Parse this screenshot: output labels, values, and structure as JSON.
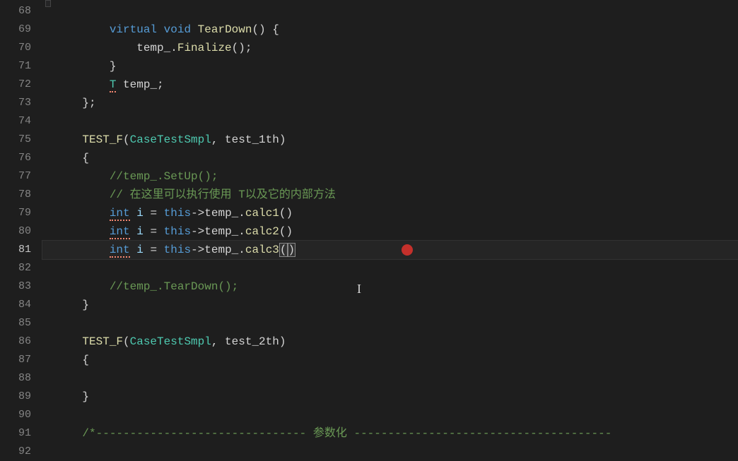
{
  "editor": {
    "first_line": 68,
    "active_line": 81,
    "lines": {
      "68": [
        {
          "t": "",
          "c": ""
        }
      ],
      "69": [
        {
          "t": "        ",
          "c": ""
        },
        {
          "t": "virtual",
          "c": "kw-virtual"
        },
        {
          "t": " ",
          "c": ""
        },
        {
          "t": "void",
          "c": "kw-void"
        },
        {
          "t": " ",
          "c": ""
        },
        {
          "t": "TearDown",
          "c": "kw-func"
        },
        {
          "t": "() {",
          "c": ""
        }
      ],
      "70": [
        {
          "t": "            ",
          "c": ""
        },
        {
          "t": "temp_",
          "c": "kw-member"
        },
        {
          "t": ".",
          "c": ""
        },
        {
          "t": "Finalize",
          "c": "kw-func"
        },
        {
          "t": "();",
          "c": ""
        }
      ],
      "71": [
        {
          "t": "        }",
          "c": ""
        }
      ],
      "72": [
        {
          "t": "        ",
          "c": ""
        },
        {
          "t": "T",
          "c": "kw-type underline-err"
        },
        {
          "t": " ",
          "c": ""
        },
        {
          "t": "temp_",
          "c": "kw-member"
        },
        {
          "t": ";",
          "c": ""
        }
      ],
      "73": [
        {
          "t": "    };",
          "c": ""
        }
      ],
      "74": [
        {
          "t": "",
          "c": ""
        }
      ],
      "75": [
        {
          "t": "    ",
          "c": ""
        },
        {
          "t": "TEST_F",
          "c": "kw-macro"
        },
        {
          "t": "(",
          "c": ""
        },
        {
          "t": "CaseTestSmpl",
          "c": "kw-class"
        },
        {
          "t": ", ",
          "c": ""
        },
        {
          "t": "test_1th",
          "c": "kw-member"
        },
        {
          "t": ")",
          "c": ""
        }
      ],
      "76": [
        {
          "t": "    {",
          "c": ""
        }
      ],
      "77": [
        {
          "t": "        ",
          "c": ""
        },
        {
          "t": "//temp_.SetUp();",
          "c": "kw-comment"
        }
      ],
      "78": [
        {
          "t": "        ",
          "c": ""
        },
        {
          "t": "// 在这里可以执行使用 T以及它的内部方法",
          "c": "kw-comment"
        }
      ],
      "79": [
        {
          "t": "        ",
          "c": ""
        },
        {
          "t": "int",
          "c": "kw-int underline-err"
        },
        {
          "t": " ",
          "c": ""
        },
        {
          "t": "i",
          "c": "kw-var"
        },
        {
          "t": " = ",
          "c": ""
        },
        {
          "t": "this",
          "c": "kw-this"
        },
        {
          "t": "->",
          "c": ""
        },
        {
          "t": "temp_",
          "c": "kw-member"
        },
        {
          "t": ".",
          "c": ""
        },
        {
          "t": "calc1",
          "c": "kw-func"
        },
        {
          "t": "()",
          "c": ""
        }
      ],
      "80": [
        {
          "t": "        ",
          "c": ""
        },
        {
          "t": "int",
          "c": "kw-int underline-err"
        },
        {
          "t": " ",
          "c": ""
        },
        {
          "t": "i",
          "c": "kw-var"
        },
        {
          "t": " = ",
          "c": ""
        },
        {
          "t": "this",
          "c": "kw-this"
        },
        {
          "t": "->",
          "c": ""
        },
        {
          "t": "temp_",
          "c": "kw-member"
        },
        {
          "t": ".",
          "c": ""
        },
        {
          "t": "calc2",
          "c": "kw-func"
        },
        {
          "t": "()",
          "c": ""
        }
      ],
      "81": [
        {
          "t": "        ",
          "c": ""
        },
        {
          "t": "int",
          "c": "kw-int underline-err"
        },
        {
          "t": " ",
          "c": ""
        },
        {
          "t": "i",
          "c": "kw-var"
        },
        {
          "t": " = ",
          "c": ""
        },
        {
          "t": "this",
          "c": "kw-this"
        },
        {
          "t": "->",
          "c": ""
        },
        {
          "t": "temp_",
          "c": "kw-member"
        },
        {
          "t": ".",
          "c": ""
        },
        {
          "t": "calc3",
          "c": "kw-func"
        },
        {
          "t": "(",
          "c": "bracket-highlight"
        },
        {
          "t": ")",
          "c": "bracket-highlight"
        }
      ],
      "82": [
        {
          "t": "",
          "c": ""
        }
      ],
      "83": [
        {
          "t": "        ",
          "c": ""
        },
        {
          "t": "//temp_.TearDown();",
          "c": "kw-comment"
        }
      ],
      "84": [
        {
          "t": "    }",
          "c": ""
        }
      ],
      "85": [
        {
          "t": "",
          "c": ""
        }
      ],
      "86": [
        {
          "t": "    ",
          "c": ""
        },
        {
          "t": "TEST_F",
          "c": "kw-macro"
        },
        {
          "t": "(",
          "c": ""
        },
        {
          "t": "CaseTestSmpl",
          "c": "kw-class"
        },
        {
          "t": ", ",
          "c": ""
        },
        {
          "t": "test_2th",
          "c": "kw-member"
        },
        {
          "t": ")",
          "c": ""
        }
      ],
      "87": [
        {
          "t": "    {",
          "c": ""
        }
      ],
      "88": [
        {
          "t": "",
          "c": ""
        }
      ],
      "89": [
        {
          "t": "    }",
          "c": ""
        }
      ],
      "90": [
        {
          "t": "",
          "c": ""
        }
      ],
      "91": [
        {
          "t": "    ",
          "c": ""
        },
        {
          "t": "/*------------------------------- 参数化 --------------------------------------",
          "c": "kw-comment"
        }
      ],
      "92": [
        {
          "t": "",
          "c": ""
        }
      ]
    }
  }
}
